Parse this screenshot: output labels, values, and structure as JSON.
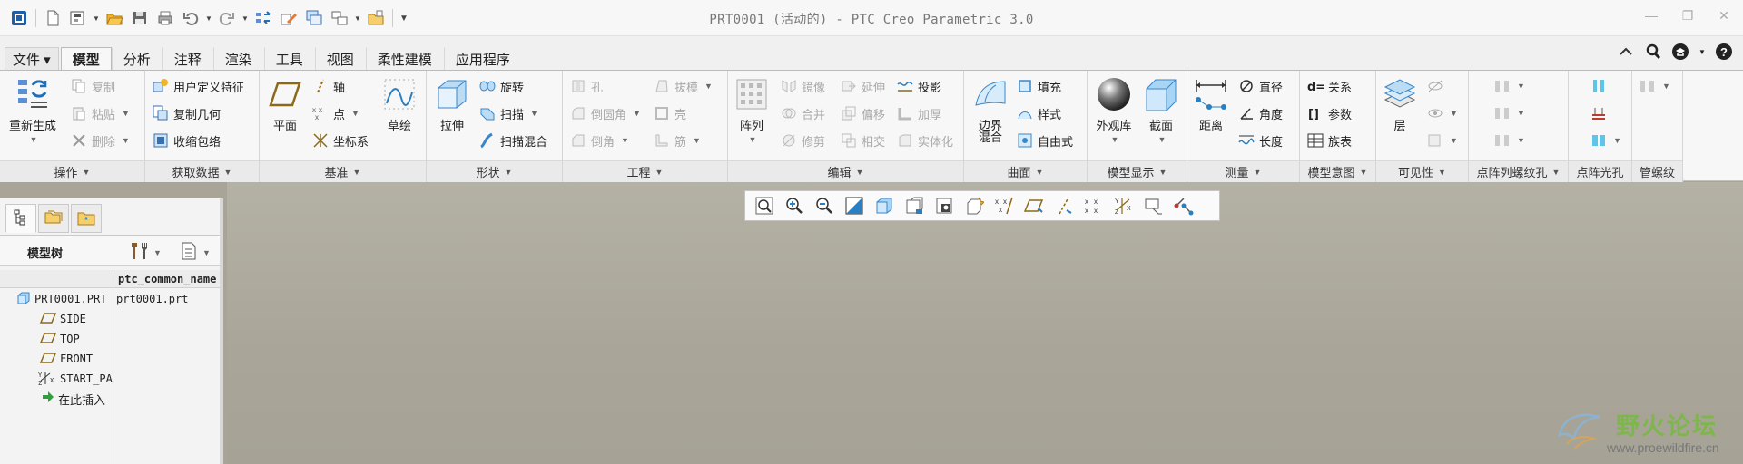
{
  "window": {
    "title": "PRT0001 (活动的) - PTC Creo Parametric 3.0"
  },
  "tabs": [
    {
      "label": "文件 ▾"
    },
    {
      "label": "模型"
    },
    {
      "label": "分析"
    },
    {
      "label": "注释"
    },
    {
      "label": "渲染"
    },
    {
      "label": "工具"
    },
    {
      "label": "视图"
    },
    {
      "label": "柔性建模"
    },
    {
      "label": "应用程序"
    }
  ],
  "ribbon": {
    "operations": {
      "footer": "操作",
      "regenerate": "重新生成",
      "copy": "复制",
      "paste": "粘贴",
      "delete": "删除"
    },
    "get_data": {
      "footer": "获取数据",
      "udf": "用户定义特征",
      "copy_geom": "复制几何",
      "shrinkwrap": "收缩包络"
    },
    "datum": {
      "footer": "基准",
      "plane": "平面",
      "axis": "轴",
      "point": "点",
      "csys": "坐标系",
      "sketch": "草绘"
    },
    "shapes": {
      "footer": "形状",
      "extrude": "拉伸",
      "revolve": "旋转",
      "sweep": "扫描",
      "swept_blend": "扫描混合"
    },
    "engineering": {
      "footer": "工程",
      "hole": "孔",
      "draft": "拔模",
      "round": "倒圆角",
      "shell": "壳",
      "chamfer": "倒角",
      "rib": "筋"
    },
    "editing": {
      "footer": "编辑",
      "pattern": "阵列",
      "mirror": "镜像",
      "extend": "延伸",
      "project": "投影",
      "merge": "合并",
      "offset": "偏移",
      "thicken": "加厚",
      "trim": "修剪",
      "intersect": "相交",
      "solidify": "实体化"
    },
    "surfaces": {
      "footer": "曲面",
      "boundary_blend": "边界混合",
      "fill": "填充",
      "style": "样式",
      "freestyle": "自由式"
    },
    "model_display": {
      "footer": "模型显示",
      "appearance": "外观库",
      "section": "截面"
    },
    "measure": {
      "footer": "测量",
      "distance": "距离",
      "diameter": "直径",
      "angle": "角度",
      "length": "长度"
    },
    "model_intent": {
      "footer": "模型意图",
      "relations": "关系",
      "parameters": "参数",
      "family_table": "族表"
    },
    "visibility": {
      "footer": "可见性",
      "layers": "层"
    },
    "point_pattern_thread": {
      "footer": "点阵列螺纹孔"
    },
    "point_pattern_hole": {
      "footer": "点阵光孔"
    },
    "pipe_thread": {
      "footer": "管螺纹"
    }
  },
  "model_tree": {
    "label": "模型树",
    "column_header": "ptc_common_name",
    "items": [
      {
        "name": "PRT0001.PRT",
        "value": "prt0001.prt"
      },
      {
        "name": "SIDE",
        "value": ""
      },
      {
        "name": "TOP",
        "value": ""
      },
      {
        "name": "FRONT",
        "value": ""
      },
      {
        "name": "START_PART_CSYS",
        "value": ""
      },
      {
        "name": "在此插入",
        "value": ""
      }
    ]
  },
  "watermark": {
    "title": "野火论坛",
    "url": "www.proewildfire.cn"
  },
  "colors": {
    "graphics_bg": "#a9a699",
    "ribbon_bg": "#f7f7f7",
    "accent_blue": "#1f6fb5"
  }
}
